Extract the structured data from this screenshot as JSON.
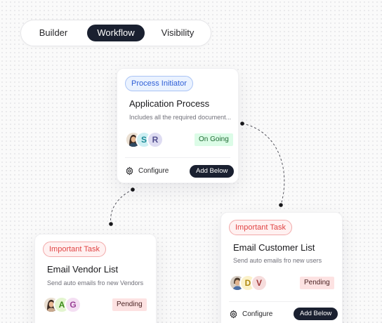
{
  "tabs": [
    {
      "label": "Builder",
      "active": false
    },
    {
      "label": "Workflow",
      "active": true
    },
    {
      "label": "Visibility",
      "active": false
    }
  ],
  "cards": {
    "process": {
      "badge": "Process Initiator",
      "title": "Application Process",
      "description": "Includes all the required document...",
      "avatars": [
        "photo",
        "S",
        "R"
      ],
      "status": "On Going",
      "configure_label": "Configure",
      "add_label": "Add Below"
    },
    "vendor": {
      "badge": "Important Task",
      "title": "Email Vendor List",
      "description": "Send auto emails fro new Vendors",
      "avatars": [
        "photo",
        "A",
        "G"
      ],
      "status": "Pending"
    },
    "customer": {
      "badge": "Important Task",
      "title": "Email Customer List",
      "description": "Send auto emails fro new users",
      "avatars": [
        "photo",
        "D",
        "V"
      ],
      "status": "Pending",
      "configure_label": "Configure",
      "add_label": "Add Below"
    }
  },
  "colors": {
    "accent_dark": "#1a2030",
    "badge_blue": "#2f5fd6",
    "badge_red": "#e04444",
    "status_green_bg": "#dcfce7",
    "status_pink_bg": "#fde2e2"
  },
  "icons": {
    "configure": "gear-icon",
    "avatar_photo": "person-photo-avatar"
  }
}
